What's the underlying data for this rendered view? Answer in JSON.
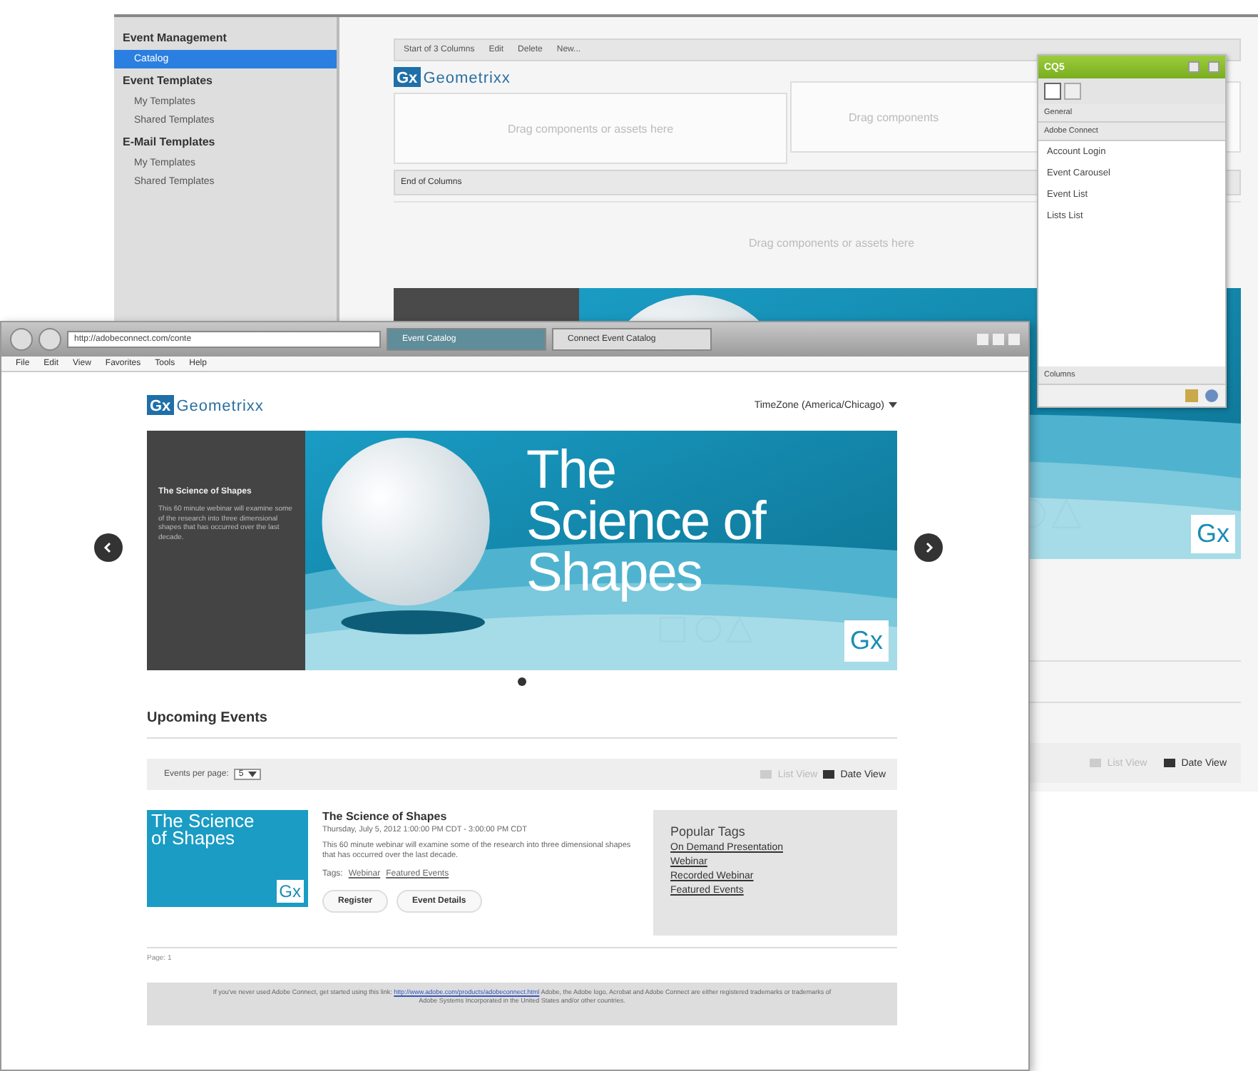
{
  "author_window": {
    "sidebar": {
      "items": [
        {
          "label": "Event Management",
          "kind": "heading",
          "selected": false
        },
        {
          "label": "Catalog",
          "kind": "item",
          "selected": true
        },
        {
          "label": "Event Templates",
          "kind": "heading",
          "selected": false
        },
        {
          "label": "My Templates",
          "kind": "item",
          "selected": false
        },
        {
          "label": "Shared Templates",
          "kind": "item",
          "selected": false
        },
        {
          "label": "E-Mail Templates",
          "kind": "heading",
          "selected": false
        },
        {
          "label": "My Templates",
          "kind": "item",
          "selected": false
        },
        {
          "label": "Shared Templates",
          "kind": "item",
          "selected": false
        }
      ]
    },
    "toolbar": [
      "Start of 3 Columns",
      "Edit",
      "Delete",
      "New..."
    ],
    "logo": {
      "mark": "Gx",
      "name": "Geometrixx"
    },
    "column_zones": [
      "Drag components or assets here",
      "Drag components"
    ],
    "end_columns": "End of Columns",
    "drop_zone": "Drag components or assets here",
    "banner_logo": "Gx",
    "view_buttons": [
      {
        "label": "List View",
        "selected": false
      },
      {
        "label": "Date View",
        "selected": true
      }
    ]
  },
  "sidekick": {
    "title": "CQ5",
    "tabs": [
      {
        "selected": true
      },
      {
        "selected": false
      }
    ],
    "sections": [
      {
        "label": "General"
      },
      {
        "label": "Adobe Connect"
      }
    ],
    "components": [
      "Account Login",
      "Event Carousel",
      "Event List",
      "Lists List"
    ],
    "footer_section": "Columns"
  },
  "browser": {
    "address": "http://adobeconnect.com/conte",
    "tabs": [
      {
        "label": "Event Catalog",
        "selected": true
      },
      {
        "label": "Connect Event Catalog",
        "selected": false
      }
    ],
    "menu": [
      "File",
      "Edit",
      "View",
      "Favorites",
      "Tools",
      "Help"
    ],
    "page": {
      "logo": {
        "mark": "Gx",
        "name": "Geometrixx"
      },
      "timezone": "TimeZone (America/Chicago)",
      "carousel": {
        "panel_title": "The Science of Shapes",
        "panel_text": "This 60 minute webinar will examine some of the research into three dimensional shapes that has occurred over the last decade.",
        "image_title": "The Science of Shapes",
        "image_logo": "Gx",
        "dots": [
          {
            "selected": true
          }
        ]
      },
      "heading": "Upcoming Events",
      "per_page_label": "Events per page:",
      "per_page_value": "5",
      "view_buttons": [
        {
          "label": "List View",
          "selected": false
        },
        {
          "label": "Date View",
          "selected": true
        }
      ],
      "event": {
        "thumb_title": "The Science of Shapes",
        "thumb_logo": "Gx",
        "title": "The Science of Shapes",
        "date": "Thursday, July 5, 2012 1:00:00 PM CDT - 3:00:00 PM CDT",
        "description": "This 60 minute webinar will examine some of the research into three dimensional shapes that has occurred over the last decade.",
        "tags_label": "Tags:",
        "tags": [
          "Webinar",
          "Featured Events"
        ],
        "buttons": [
          "Register",
          "Event Details"
        ]
      },
      "popular_tags": {
        "title": "Popular Tags",
        "links": [
          "On Demand Presentation",
          "Webinar",
          "Recorded Webinar",
          "Featured Events"
        ]
      },
      "pager": "Page: 1",
      "footer": {
        "before": "If you've never used Adobe Connect, get started using this link:",
        "link": "http://www.adobe.com/products/adobeconnect.html",
        "after": "Adobe, the Adobe logo, Acrobat and Adobe Connect are either registered trademarks or trademarks of Adobe Systems Incorporated in the United States and/or other countries."
      }
    }
  }
}
